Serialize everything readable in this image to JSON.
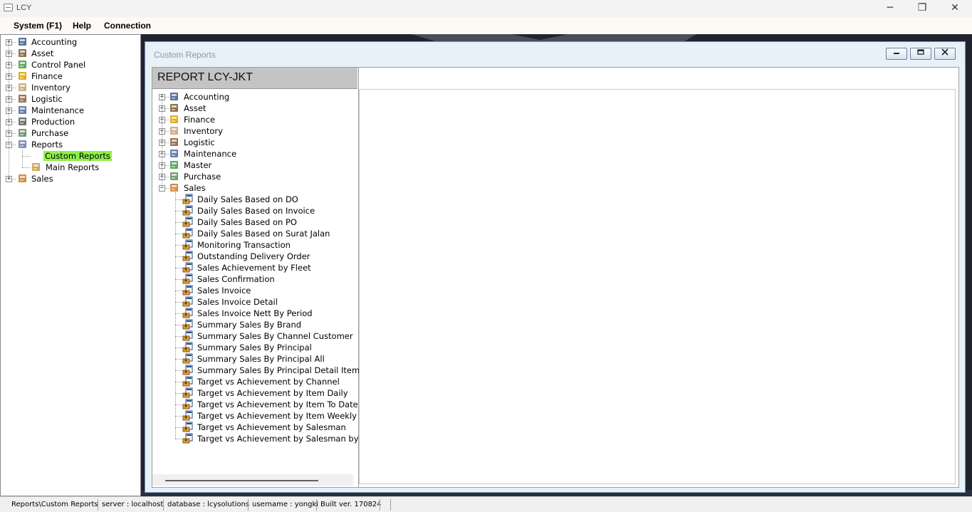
{
  "window": {
    "title": "LCY",
    "minimize": "─",
    "restore": "❐",
    "close": "✕"
  },
  "menu": [
    "System (F1)",
    "Help",
    "Connection"
  ],
  "left_tree": {
    "items": [
      {
        "label": "Accounting",
        "icon": "accounting-icon",
        "color": "#3a5a8c"
      },
      {
        "label": "Asset",
        "icon": "asset-icon",
        "color": "#7a5a2a"
      },
      {
        "label": "Control Panel",
        "icon": "control-panel-icon",
        "color": "#3e9b3e"
      },
      {
        "label": "Finance",
        "icon": "finance-icon",
        "color": "#d8a000"
      },
      {
        "label": "Inventory",
        "icon": "inventory-icon",
        "color": "#c8a070"
      },
      {
        "label": "Logistic",
        "icon": "logistic-icon",
        "color": "#8a5a3a"
      },
      {
        "label": "Maintenance",
        "icon": "maintenance-icon",
        "color": "#4a6a9a"
      },
      {
        "label": "Production",
        "icon": "production-icon",
        "color": "#5a5a5a"
      },
      {
        "label": "Purchase",
        "icon": "purchase-icon",
        "color": "#5a8a5a"
      },
      {
        "label": "Reports",
        "icon": "reports-icon",
        "color": "#6a7aa8"
      },
      {
        "label": "Custom Reports",
        "icon": "",
        "color": ""
      },
      {
        "label": "Main Reports",
        "icon": "main-reports-icon",
        "color": "#c89a3a"
      },
      {
        "label": "Sales",
        "icon": "sales-icon",
        "color": "#c87a2a"
      }
    ]
  },
  "child_window": {
    "title": "Custom Reports",
    "header": "REPORT LCY-JKT",
    "categories": [
      {
        "label": "Accounting",
        "icon": "accounting-icon",
        "color": "#3a5a8c"
      },
      {
        "label": "Asset",
        "icon": "asset-icon",
        "color": "#7a5a2a"
      },
      {
        "label": "Finance",
        "icon": "finance-icon",
        "color": "#d8a000"
      },
      {
        "label": "Inventory",
        "icon": "inventory-icon",
        "color": "#c8a070"
      },
      {
        "label": "Logistic",
        "icon": "logistic-icon",
        "color": "#8a5a3a"
      },
      {
        "label": "Maintenance",
        "icon": "maintenance-icon",
        "color": "#4a6a9a"
      },
      {
        "label": "Master",
        "icon": "master-icon",
        "color": "#3e9b3e"
      },
      {
        "label": "Purchase",
        "icon": "purchase-icon",
        "color": "#5a8a5a"
      },
      {
        "label": "Sales",
        "icon": "sales-icon",
        "color": "#c87a2a"
      }
    ],
    "sales_reports": [
      "Daily Sales Based on DO",
      "Daily Sales Based on Invoice",
      "Daily Sales Based on PO",
      "Daily Sales Based on Surat Jalan",
      "Monitoring Transaction",
      "Outstanding Delivery Order",
      "Sales Achievement by Fleet",
      "Sales Confirmation",
      "Sales Invoice",
      "Sales Invoice Detail",
      "Sales Invoice Nett By Period",
      "Summary Sales By Brand",
      "Summary Sales By Channel Customer",
      "Summary Sales By Principal",
      "Summary Sales By Principal All",
      "Summary Sales By Principal Detail Item",
      "Target vs Achievement by Channel",
      "Target vs Achievement by Item Daily",
      "Target vs Achievement by Item To Date",
      "Target vs Achievement by Item Weekly",
      "Target vs Achievement by Salesman",
      "Target vs Achievement by Salesman by C"
    ]
  },
  "status": [
    "Reports\\Custom Reports",
    "server : localhost",
    "database : lcysolutions",
    "username : yongki",
    "Built ver. 170824"
  ]
}
